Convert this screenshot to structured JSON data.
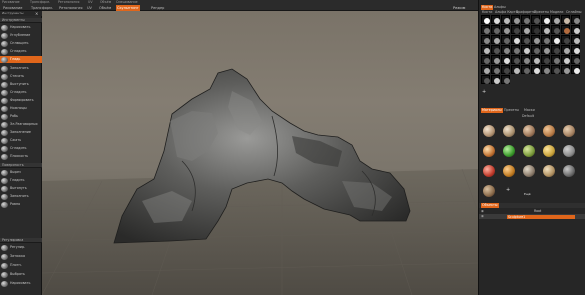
{
  "topbar": {
    "menu_items": [
      "Рисование",
      "Трансформ.",
      "Ретопология",
      "UV",
      "Объём",
      "Смешивание"
    ],
    "tabs": [
      "Рисование",
      "Трансформ.",
      "Ретопология",
      "UV",
      "Объём",
      "Скульптинг",
      "Рендер"
    ],
    "active_tab": "Скульптинг",
    "right_label": "Режим"
  },
  "left_tabs": {
    "tab1": "Инструменты",
    "close": "×"
  },
  "sidebar": {
    "sections": [
      {
        "header": "Инструменты",
        "tools": [
          "Нарисовать",
          "Углубление",
          "Сплющить",
          "Сгладить",
          "Гладь"
        ]
      },
      {
        "header": "",
        "tools": [
          "Заполнить",
          "Стесать",
          "Выступить",
          "Сгладить",
          "Формировать",
          "Ножницы",
          "Рябь",
          "Эл.Разговорных",
          "Заполнение",
          "Сжать",
          "Сгладить",
          "Плоскость"
        ]
      },
      {
        "header": "Поверхность",
        "tools": [
          "Вырез",
          "Гладить",
          "Вытянуть",
          "Заполнить",
          "Ровно"
        ]
      },
      {
        "header": "Регулировка",
        "tools": [
          "Регулир.",
          "Затяжка",
          "Плотн.",
          "Выбрать",
          "Нарисовать"
        ]
      }
    ],
    "active_tool": "Гладь"
  },
  "right_panel": {
    "top_tabs": [
      "Кисти",
      "Альфы"
    ],
    "active_top_tab": "Кисти",
    "sub_tabs": [
      "Кисти",
      "Альфа Карты",
      "Трафареты",
      "Пресеты",
      "Модели",
      "Сплайны"
    ],
    "mat_tabs": [
      "Материалы",
      "Пресеты",
      "Маски"
    ],
    "active_mat_tab": "Материалы",
    "mat_header": "Default",
    "layers_tab": "Объекты",
    "layers": [
      {
        "name": "Root"
      },
      {
        "name": "Sculpture1",
        "active": true
      }
    ],
    "add_label": "+",
    "more_label": "Ещё"
  },
  "colors": {
    "accent": "#e0661b",
    "panel": "#2a2a2a",
    "viewport_top": "#7a7368",
    "viewport_bottom": "#58544c"
  }
}
